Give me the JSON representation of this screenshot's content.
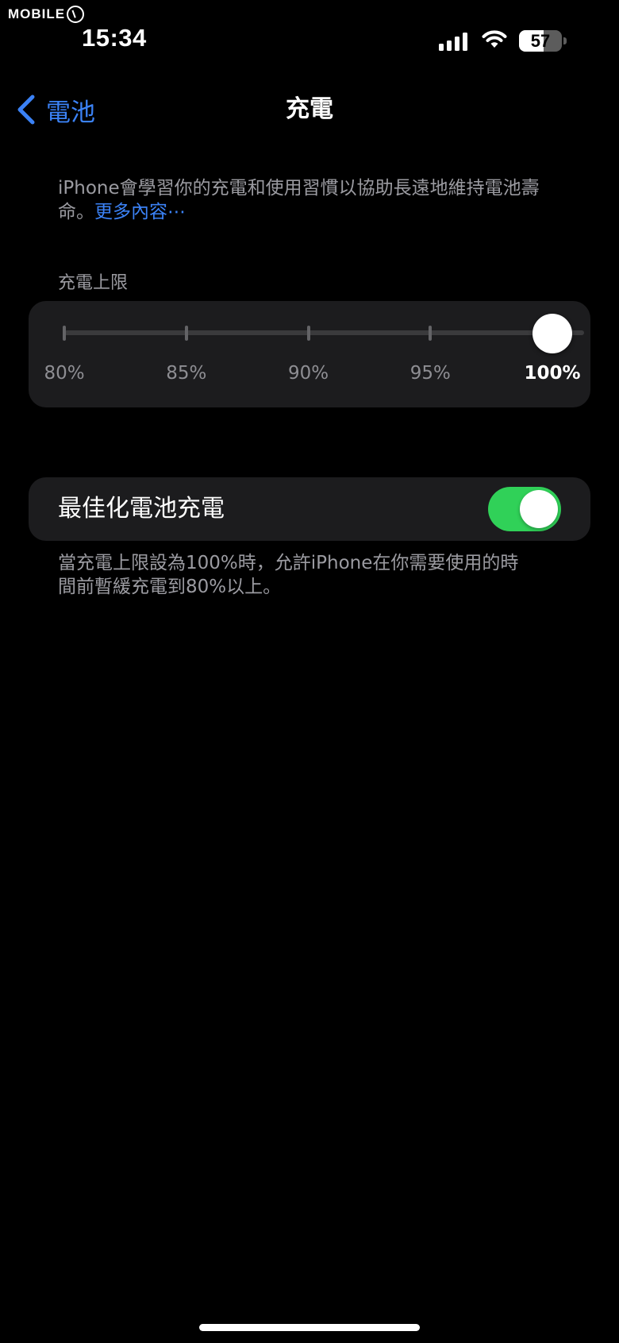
{
  "watermark": {
    "text": "MOBILE"
  },
  "status_bar": {
    "time": "15:34",
    "signal_icon": "cellular-signal-icon",
    "wifi_icon": "wifi-icon",
    "battery_percent": "57",
    "battery_level": 0.57
  },
  "nav": {
    "back_label": "電池",
    "back_icon": "chevron-left-icon",
    "title": "充電"
  },
  "intro": {
    "text": "iPhone會學習你的充電和使用習慣以協助長遠地維持電池壽命。",
    "link": "更多內容⋯"
  },
  "charge_limit": {
    "section_label": "充電上限",
    "options": [
      "80%",
      "85%",
      "90%",
      "95%",
      "100%"
    ],
    "selected_index": 4,
    "selected_value": "100%"
  },
  "optimized_charging": {
    "label": "最佳化電池充電",
    "enabled": true,
    "toggle_color": "#30d158",
    "footnote": "當充電上限設為100%時，允許iPhone在你需要使用的時間前暫緩充電到80%以上。"
  },
  "colors": {
    "accent": "#3b82f6",
    "background": "#000000",
    "card": "#1c1c1e",
    "secondary_text": "#9b9ba1"
  }
}
